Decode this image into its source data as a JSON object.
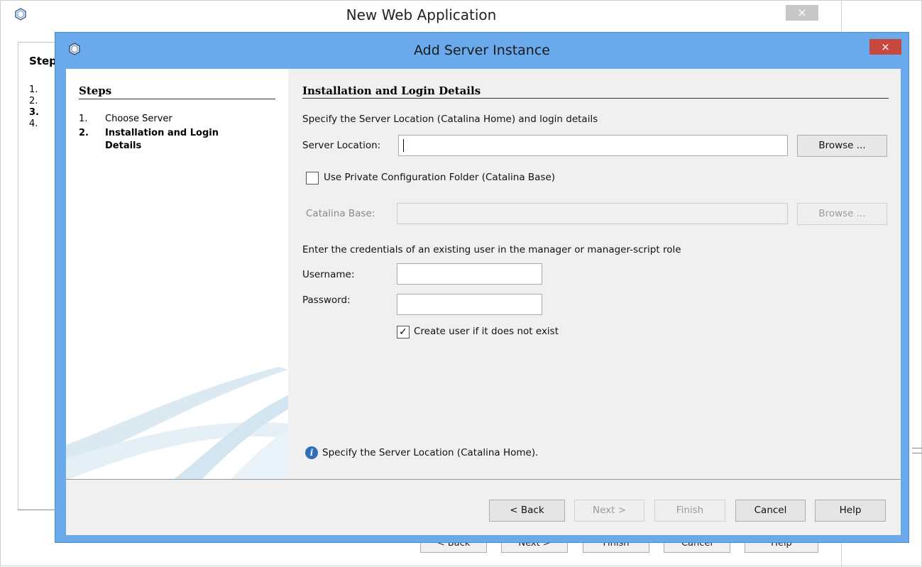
{
  "background_window": {
    "title": "New Web Application",
    "close_label": "×",
    "steps_title": "Step",
    "steps": [
      "1.",
      "2.",
      "3.",
      "4."
    ],
    "buttons": [
      "< Back",
      "Next >",
      "Finish",
      "Cancel",
      "Help"
    ]
  },
  "dialog": {
    "title": "Add Server Instance",
    "close_label": "×",
    "steps_title": "Steps",
    "steps": [
      {
        "num": "1.",
        "label": "Choose Server",
        "active": false
      },
      {
        "num": "2.",
        "label": "Installation and Login Details",
        "active": true
      }
    ],
    "section_title": "Installation and Login Details",
    "intro_text": "Specify the Server Location (Catalina Home) and login details",
    "server_location": {
      "label": "Server Location:",
      "value": ""
    },
    "browse_label": "Browse ...",
    "private_config": {
      "label": "Use Private Configuration Folder (Catalina Base)",
      "checked": false
    },
    "catalina_base": {
      "label": "Catalina Base:",
      "value": ""
    },
    "browse_disabled_label": "Browse ...",
    "credentials_text": "Enter the credentials of an existing user in the manager or manager-script role",
    "username": {
      "label": "Username:",
      "value": ""
    },
    "password": {
      "label": "Password:",
      "value": ""
    },
    "create_user": {
      "label": "Create user if it does not exist",
      "checked": true,
      "mark": "✓"
    },
    "info_icon_glyph": "i",
    "info_message": "Specify the Server Location (Catalina Home).",
    "footer": {
      "back": "< Back",
      "next": "Next >",
      "finish": "Finish",
      "cancel": "Cancel",
      "help": "Help"
    }
  },
  "colors": {
    "dialog_frame": "#6aa9ec",
    "close_button": "#c7483f",
    "info_icon": "#2f6fb8"
  }
}
